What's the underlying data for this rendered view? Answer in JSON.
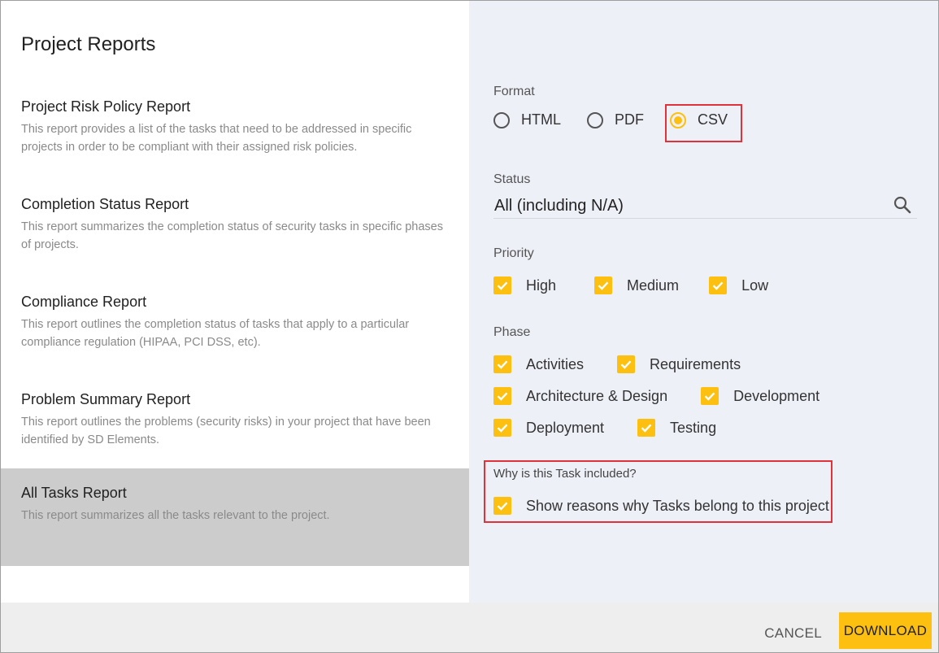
{
  "dialog": {
    "title": "Project Reports"
  },
  "reports": [
    {
      "name": "Project Risk Policy Report",
      "description": "This report provides a list of the tasks that need to be addressed in specific projects in order to be compliant with their assigned risk policies."
    },
    {
      "name": "Completion Status Report",
      "description": "This report summarizes the completion status of security tasks in specific phases of projects."
    },
    {
      "name": "Compliance Report",
      "description": "This report outlines the completion status of tasks that apply to a particular compliance regulation (HIPAA, PCI DSS, etc)."
    },
    {
      "name": "Problem Summary Report",
      "description": "This report outlines the problems (security risks) in your project that have been identified by SD Elements."
    },
    {
      "name": "All Tasks Report",
      "description": "This report summarizes all the tasks relevant to the project.",
      "selected": true
    }
  ],
  "options": {
    "format": {
      "label": "Format",
      "choices": [
        "HTML",
        "PDF",
        "CSV"
      ],
      "selected": "CSV"
    },
    "status": {
      "label": "Status",
      "value": "All (including N/A)",
      "icon": "search-icon"
    },
    "priority": {
      "label": "Priority",
      "items": [
        {
          "label": "High",
          "checked": true
        },
        {
          "label": "Medium",
          "checked": true
        },
        {
          "label": "Low",
          "checked": true
        }
      ]
    },
    "phase": {
      "label": "Phase",
      "items": [
        {
          "label": "Activities",
          "checked": true
        },
        {
          "label": "Requirements",
          "checked": true
        },
        {
          "label": "Architecture & Design",
          "checked": true
        },
        {
          "label": "Development",
          "checked": true
        },
        {
          "label": "Deployment",
          "checked": true
        },
        {
          "label": "Testing",
          "checked": true
        }
      ]
    },
    "why": {
      "label": "Why is this Task included?",
      "checkbox_label": "Show reasons why Tasks belong to this project",
      "checked": true
    }
  },
  "footer": {
    "cancel_label": "CANCEL",
    "download_label": "DOWNLOAD"
  },
  "colors": {
    "accent": "#fdc010",
    "highlight_outline": "#e0323b",
    "selected_row": "#cccccc",
    "right_panel_bg": "#eef0f8"
  }
}
